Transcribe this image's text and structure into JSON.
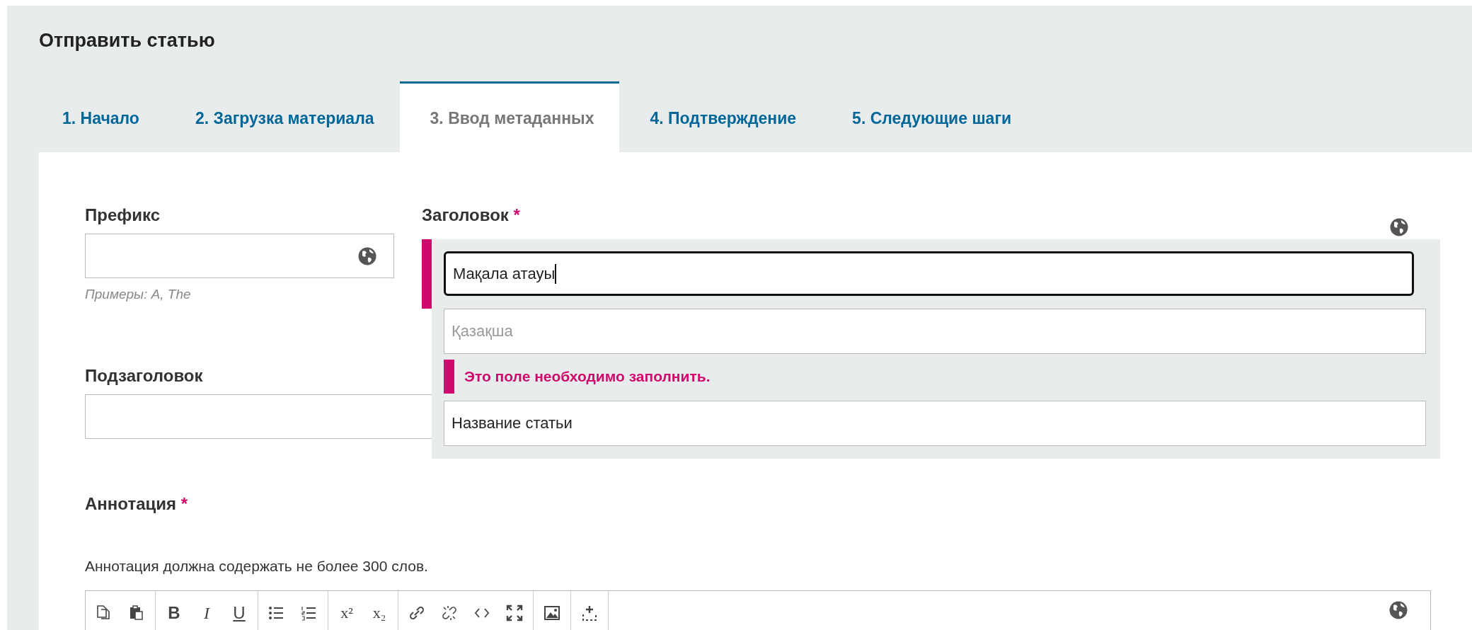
{
  "page_title": "Отправить статью",
  "tabs": [
    {
      "label": "1. Начало",
      "selected": false
    },
    {
      "label": "2. Загрузка материала",
      "selected": false
    },
    {
      "label": "3. Ввод метаданных",
      "selected": true
    },
    {
      "label": "4. Подтверждение",
      "selected": false
    },
    {
      "label": "5. Следующие шаги",
      "selected": false
    }
  ],
  "prefix": {
    "label": "Префикс",
    "hint": "Примеры: A, The"
  },
  "title_field": {
    "label": "Заголовок",
    "required_mark": "*",
    "value": "Мақала атауы",
    "focused": true,
    "locales": [
      {
        "placeholder": "Қазақша",
        "error": "Это поле необходимо заполнить."
      },
      {
        "value": "Название статьи"
      }
    ]
  },
  "subtitle": {
    "label": "Подзаголовок"
  },
  "abstract": {
    "label": "Аннотация",
    "required_mark": "*",
    "help": "Аннотация должна содержать не более 300 слов.",
    "toolbar": [
      [
        {
          "kind": "copy"
        },
        {
          "kind": "paste"
        }
      ],
      [
        {
          "kind": "bold",
          "label": "B"
        },
        {
          "kind": "italic",
          "label": "I"
        },
        {
          "kind": "underline",
          "label": "U"
        }
      ],
      [
        {
          "kind": "bullets"
        },
        {
          "kind": "numbers"
        }
      ],
      [
        {
          "kind": "plain",
          "label": "x²"
        },
        {
          "kind": "plain",
          "label": "x₂"
        }
      ],
      [
        {
          "kind": "link"
        },
        {
          "kind": "unlink"
        },
        {
          "kind": "code"
        },
        {
          "kind": "fullscreen"
        }
      ],
      [
        {
          "kind": "image"
        }
      ],
      [
        {
          "kind": "upload"
        }
      ]
    ]
  }
}
